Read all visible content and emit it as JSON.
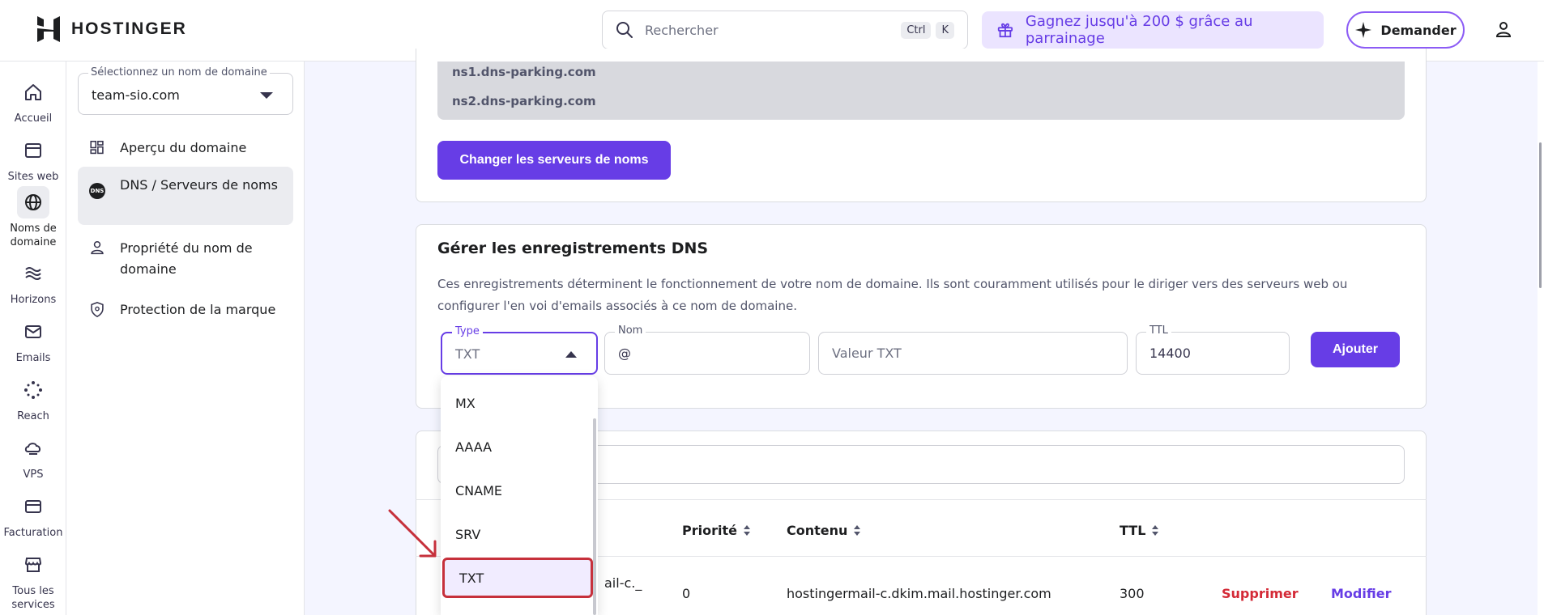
{
  "header": {
    "logo_text": "HOSTINGER",
    "search_placeholder": "Rechercher",
    "shortcut_ctrl": "Ctrl",
    "shortcut_key": "K",
    "referral_text": "Gagnez jusqu'à 200 $ grâce au parrainage",
    "ask_label": "Demander"
  },
  "rail": {
    "items": [
      {
        "label": "Accueil",
        "icon": "home-icon"
      },
      {
        "label": "Sites web",
        "icon": "browser-icon"
      },
      {
        "label": "Noms de domaine",
        "icon": "globe-icon",
        "active": true
      },
      {
        "label": "Horizons",
        "icon": "waves-icon"
      },
      {
        "label": "Emails",
        "icon": "mail-icon"
      },
      {
        "label": "Reach",
        "icon": "sparkle-icon"
      },
      {
        "label": "VPS",
        "icon": "cloud-server-icon"
      },
      {
        "label": "Facturation",
        "icon": "card-icon"
      },
      {
        "label": "Tous les services",
        "icon": "store-icon"
      }
    ]
  },
  "sidebar": {
    "select_label": "Sélectionnez un nom de domaine",
    "select_value": "team-sio.com",
    "items": [
      {
        "label": "Aperçu du domaine",
        "icon": "dashboard-icon"
      },
      {
        "label": "DNS / Serveurs de noms",
        "icon": "dns-icon",
        "active": true
      },
      {
        "label": "Propriété du nom de domaine",
        "icon": "person-icon"
      },
      {
        "label": "Protection de la marque",
        "icon": "shield-icon"
      }
    ],
    "dns_badge": "DNS"
  },
  "nameservers": {
    "ns1": "ns1.dns-parking.com",
    "ns2": "ns2.dns-parking.com",
    "change_button": "Changer les serveurs de noms"
  },
  "dns": {
    "title": "Gérer les enregistrements DNS",
    "description": "Ces enregistrements déterminent le fonctionnement de votre nom de domaine. Ils sont couramment utilisés pour le diriger vers des serveurs web ou configurer l'en voi d'emails associés à ce nom de domaine.",
    "type_label": "Type",
    "type_value": "TXT",
    "name_label": "Nom",
    "name_value": "@",
    "value_placeholder": "Valeur TXT",
    "ttl_label": "TTL",
    "ttl_value": "14400",
    "add_button": "Ajouter"
  },
  "dropdown": {
    "options": [
      "MX",
      "AAAA",
      "CNAME",
      "SRV",
      "TXT"
    ],
    "highlighted": "TXT"
  },
  "table": {
    "headers": {
      "priority": "Priorité",
      "content": "Contenu",
      "ttl": "TTL"
    },
    "row": {
      "name_fragment": "ail-c._",
      "priority": "0",
      "content": "hostingermail-c.dkim.mail.hostinger.com",
      "ttl": "300",
      "delete": "Supprimer",
      "edit": "Modifier"
    }
  },
  "colors": {
    "primary": "#673de6",
    "danger": "#d42a37",
    "highlight_border": "#c6303b"
  }
}
